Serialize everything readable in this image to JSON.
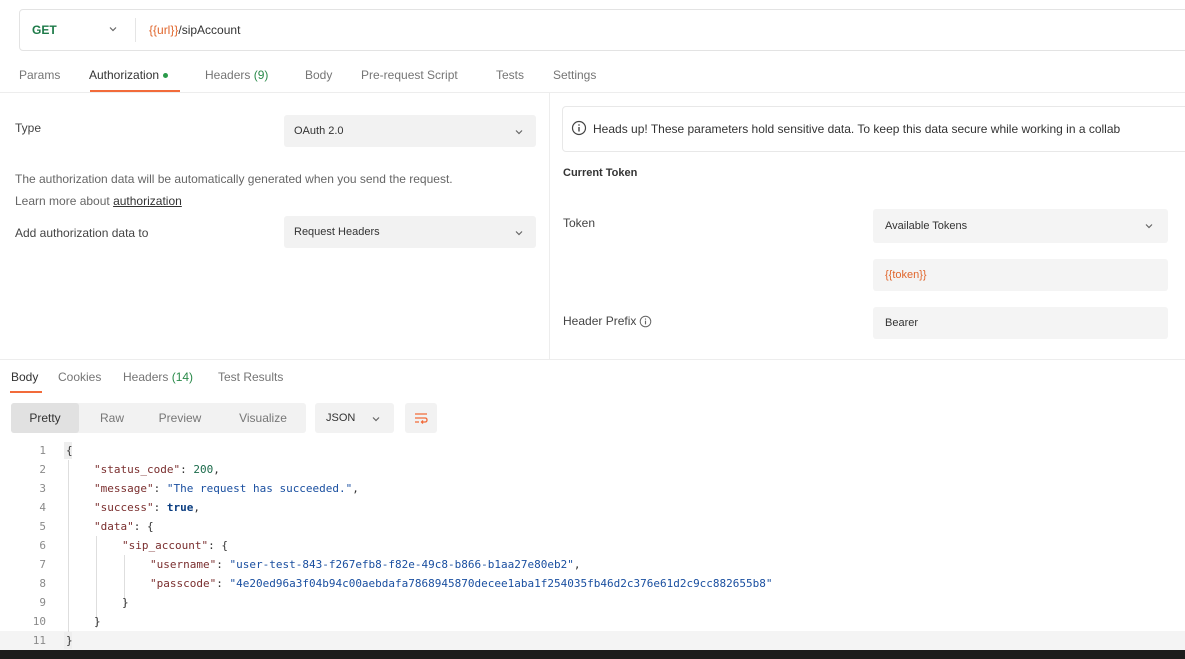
{
  "request": {
    "method": "GET",
    "url_var": "{{url}}",
    "url_path": "/sipAccount"
  },
  "request_tabs": [
    {
      "label": "Params"
    },
    {
      "label": "Authorization"
    },
    {
      "label": "Headers",
      "count": "(9)"
    },
    {
      "label": "Body"
    },
    {
      "label": "Pre-request Script"
    },
    {
      "label": "Tests"
    },
    {
      "label": "Settings"
    }
  ],
  "auth": {
    "type_label": "Type",
    "type_value": "OAuth 2.0",
    "description": "The authorization data will be automatically generated when you send the request.",
    "learn_more_prefix": "Learn more about",
    "learn_more_link": "authorization",
    "add_to_label": "Add authorization data to",
    "add_to_value": "Request Headers"
  },
  "token_panel": {
    "heads_up": "Heads up! These parameters hold sensitive data. To keep this data secure while working in a collab",
    "current_token": "Current Token",
    "token_label": "Token",
    "token_select": "Available Tokens",
    "token_value": "{{token}}",
    "header_prefix_label": "Header Prefix",
    "header_prefix_value": "Bearer"
  },
  "response_tabs": [
    {
      "label": "Body"
    },
    {
      "label": "Cookies"
    },
    {
      "label": "Headers",
      "count": "(14)"
    },
    {
      "label": "Test Results"
    }
  ],
  "view_modes": [
    "Pretty",
    "Raw",
    "Preview",
    "Visualize"
  ],
  "language": "JSON",
  "code_lines": [
    {
      "n": "1"
    },
    {
      "n": "2",
      "key": "\"status_code\"",
      "value": "200"
    },
    {
      "n": "3",
      "key": "\"message\"",
      "value": "\"The request has succeeded.\""
    },
    {
      "n": "4",
      "key": "\"success\"",
      "value": "true"
    },
    {
      "n": "5",
      "key": "\"data\""
    },
    {
      "n": "6",
      "key": "\"sip_account\""
    },
    {
      "n": "7",
      "key": "\"username\"",
      "value": "\"user-test-843-f267efb8-f82e-49c8-b866-b1aa27e80eb2\""
    },
    {
      "n": "8",
      "key": "\"passcode\"",
      "value": "\"4e20ed96a3f04b94c00aebdafa7868945870decee1aba1f254035fb46d2c376e61d2c9cc882655b8\""
    },
    {
      "n": "9"
    },
    {
      "n": "10"
    },
    {
      "n": "11"
    }
  ],
  "colors": {
    "accent": "#f26b3a",
    "method_get": "#1d7a48",
    "variable": "#e0662c"
  }
}
